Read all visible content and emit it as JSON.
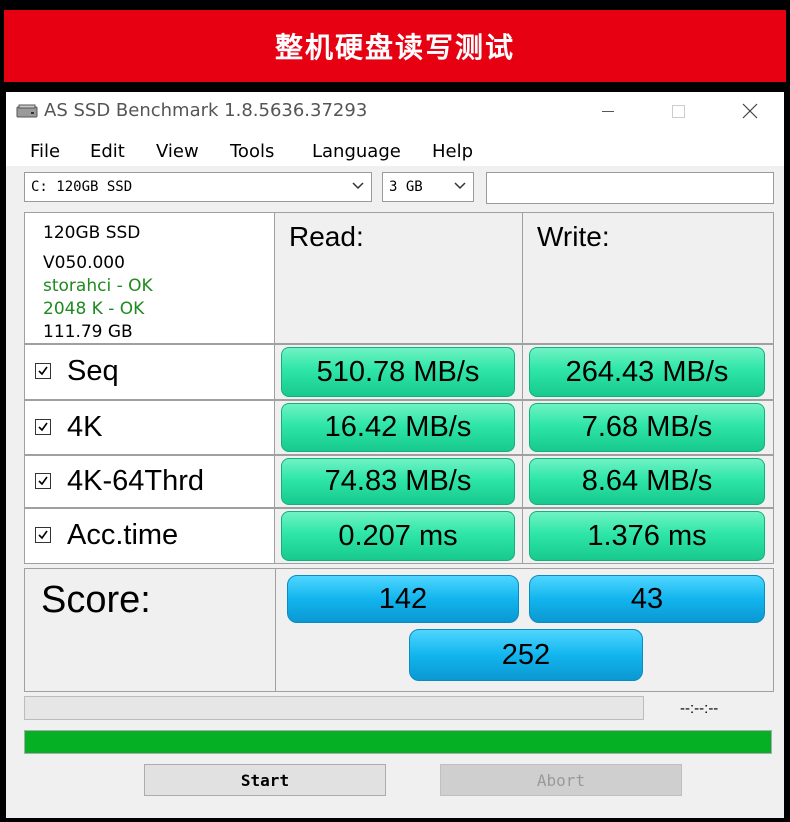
{
  "banner": {
    "title": "整机硬盘读写测试"
  },
  "window": {
    "title": "AS SSD Benchmark 1.8.5636.37293",
    "controls": {
      "minimize": "—",
      "maximize": "☐",
      "close": "✕"
    }
  },
  "menu": [
    "File",
    "Edit",
    "View",
    "Tools",
    "Language",
    "Help"
  ],
  "toolbar": {
    "drive_select": "C: 120GB SSD",
    "size_select": "3 GB",
    "text_field": ""
  },
  "drive_info": {
    "model": "120GB SSD",
    "firmware": "V050.000",
    "driver_status": "storahci - OK",
    "alignment_status": "2048 K - OK",
    "capacity": "111.79 GB",
    "ok_color": "#1f8a1f"
  },
  "columns": {
    "read": "Read:",
    "write": "Write:"
  },
  "tests": [
    {
      "name": "Seq",
      "checked": true,
      "read": "510.78 MB/s",
      "write": "264.43 MB/s"
    },
    {
      "name": "4K",
      "checked": true,
      "read": "16.42 MB/s",
      "write": "7.68 MB/s"
    },
    {
      "name": "4K-64Thrd",
      "checked": true,
      "read": "74.83 MB/s",
      "write": "8.64 MB/s"
    },
    {
      "name": "Acc.time",
      "checked": true,
      "read": "0.207 ms",
      "write": "1.376 ms"
    }
  ],
  "score": {
    "label": "Score:",
    "read": "142",
    "write": "43",
    "total": "252"
  },
  "progress": {
    "fraction": 0,
    "time_display": "--:--:--"
  },
  "status_bar": {
    "fraction": 1.0,
    "color": "#06b025"
  },
  "buttons": {
    "start": "Start",
    "abort": "Abort"
  },
  "colors": {
    "result_green": "#2ee6a8",
    "score_blue": "#12b5ee",
    "banner_red": "#e60012"
  }
}
